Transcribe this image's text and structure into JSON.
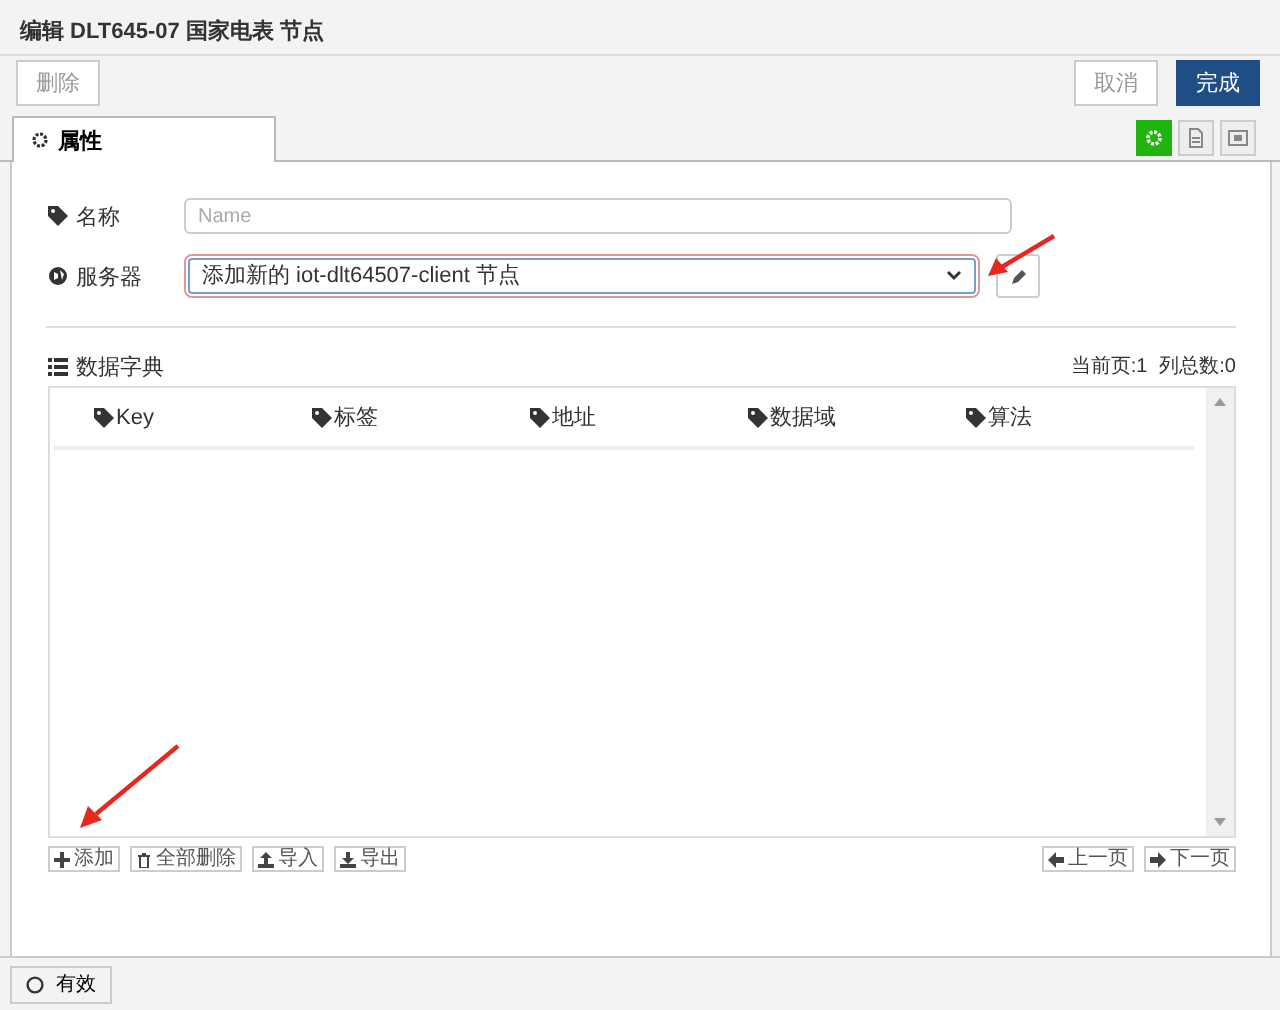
{
  "window": {
    "title": "编辑 DLT645-07 国家电表 节点"
  },
  "toolbar": {
    "delete": "删除",
    "cancel": "取消",
    "done": "完成"
  },
  "tabs": [
    {
      "label": "属性",
      "selected": true
    }
  ],
  "tab_tools": [
    {
      "kind": "settings",
      "selected": true
    },
    {
      "kind": "description",
      "selected": false
    },
    {
      "kind": "appearance",
      "selected": false
    }
  ],
  "form": {
    "name": {
      "label": "名称",
      "placeholder": "Name"
    },
    "server": {
      "label": "服务器",
      "value": "添加新的 iot-dlt64507-client 节点"
    }
  },
  "dictionary": {
    "title": "数据字典",
    "page": "当前页:1",
    "total": "列总数:0",
    "columns": [
      "Key",
      "标签",
      "地址",
      "数据域",
      "算法"
    ],
    "actions": [
      {
        "kind": "add",
        "label": "添加"
      },
      {
        "kind": "clear",
        "label": "全部删除"
      },
      {
        "kind": "import",
        "label": "导入"
      },
      {
        "kind": "export",
        "label": "导出"
      }
    ],
    "pager": [
      {
        "kind": "prev",
        "label": "上一页"
      },
      {
        "kind": "next",
        "label": "下一页"
      }
    ]
  },
  "footer": {
    "label": "有效",
    "checked": false
  }
}
